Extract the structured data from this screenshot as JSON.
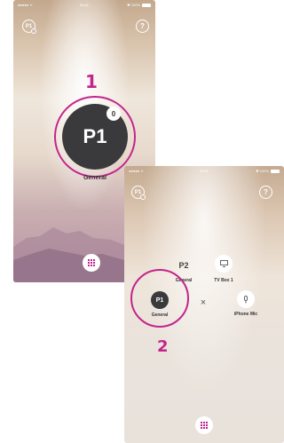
{
  "screen1": {
    "status": {
      "signal": "●●●●● ᯤ",
      "time": "09:41",
      "battery": "✱ 100%"
    },
    "profile_button": "P1",
    "help_button": "?",
    "main_profile": {
      "label": "P1",
      "badge": "0",
      "name": "General"
    },
    "step_number": "1"
  },
  "screen2": {
    "status": {
      "signal": "●●●●● ᯤ",
      "time": "09:41",
      "battery": "✱ 100%"
    },
    "profile_button": "P1",
    "help_button": "?",
    "profiles": [
      {
        "label": "P2",
        "name": "General"
      },
      {
        "label": "P1",
        "name": "General"
      }
    ],
    "devices": [
      {
        "name": "TV Box 1",
        "icon": "tv-icon"
      },
      {
        "name": "iPhone Mic",
        "icon": "microphone-icon"
      }
    ],
    "close_symbol": "×",
    "step_number": "2"
  },
  "colors": {
    "accent": "#c2258c",
    "profile_dark": "#3a3a3c"
  }
}
